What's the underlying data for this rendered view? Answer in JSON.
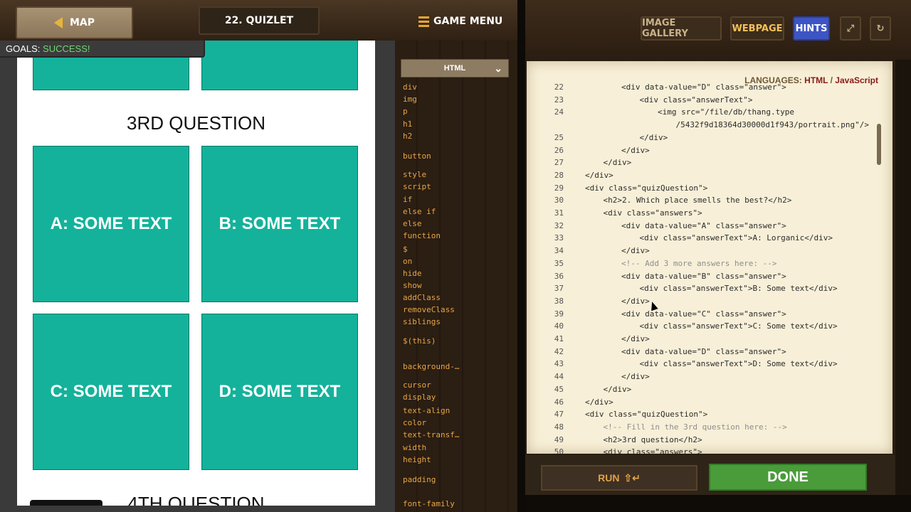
{
  "topbar": {
    "map_label": "MAP",
    "level_title": "22. QUIZLET",
    "game_menu_label": "GAME MENU",
    "goals_label": "GOALS:",
    "goals_status": "SUCCESS!",
    "colors": {
      "goals_status": "#6ed86e",
      "map_arrow": "#e6b53a"
    }
  },
  "preview": {
    "third_question_heading": "3RD QUESTION",
    "fourth_question_heading": "4TH QUESTION",
    "tiles": [
      "A: SOME TEXT",
      "B: SOME TEXT",
      "C: SOME TEXT",
      "D: SOME TEXT"
    ],
    "tile_color": "#14b29b"
  },
  "palette": {
    "dropdown_label": "HTML",
    "items": [
      "div",
      "img",
      "p",
      "h1",
      "h2",
      "button",
      "style",
      "script",
      "if",
      "else if",
      "else",
      "function",
      "$",
      "on",
      "hide",
      "show",
      "addClass",
      "removeClass",
      "siblings",
      "$(this)",
      "background-…",
      "cursor",
      "display",
      "text-align",
      "color",
      "text-transf…",
      "width",
      "height",
      "padding",
      "font-family"
    ]
  },
  "toolbar": {
    "image_gallery_label": "IMAGE GALLERY",
    "webpage_label": "WEBPAGE",
    "hints_label": "HINTS",
    "fullscreen_icon": "expand-icon",
    "reload_icon": "reload-icon"
  },
  "editor": {
    "languages_prefix": "LANGUAGES:",
    "language_html": "HTML",
    "language_sep": "/",
    "language_js": "JavaScript",
    "lines": [
      {
        "n": "22",
        "text": "<div data-value=\"D\" class=\"answer\">",
        "indent": 2
      },
      {
        "n": "23",
        "text": "<div class=\"answerText\">",
        "indent": 3
      },
      {
        "n": "24",
        "text": "<img src=\"/file/db/thang.type",
        "indent": 4
      },
      {
        "n": "",
        "text": "/5432f9d18364d30000d1f943/portrait.png\"/>",
        "indent": 5
      },
      {
        "n": "25",
        "text": "</div>",
        "indent": 3
      },
      {
        "n": "26",
        "text": "</div>",
        "indent": 2
      },
      {
        "n": "27",
        "text": "</div>",
        "indent": 1
      },
      {
        "n": "28",
        "text": "</div>",
        "indent": 0
      },
      {
        "n": "29",
        "text": "<div class=\"quizQuestion\">",
        "indent": 0
      },
      {
        "n": "30",
        "text": "<h2>2. Which place smells the best?</h2>",
        "indent": 1
      },
      {
        "n": "31",
        "text": "<div class=\"answers\">",
        "indent": 1
      },
      {
        "n": "32",
        "text": "<div data-value=\"A\" class=\"answer\">",
        "indent": 2
      },
      {
        "n": "33",
        "text": "<div class=\"answerText\">A: Lorganic</div>",
        "indent": 3
      },
      {
        "n": "34",
        "text": "</div>",
        "indent": 2
      },
      {
        "n": "35",
        "text": "<!-- Add 3 more answers here: -->",
        "indent": 2,
        "comment": true
      },
      {
        "n": "36",
        "text": "<div data-value=\"B\" class=\"answer\">",
        "indent": 2
      },
      {
        "n": "37",
        "text": "<div class=\"answerText\">B: Some text</div>",
        "indent": 3
      },
      {
        "n": "38",
        "text": "</div>",
        "indent": 2
      },
      {
        "n": "39",
        "text": "<div data-value=\"C\" class=\"answer\">",
        "indent": 2
      },
      {
        "n": "40",
        "text": "<div class=\"answerText\">C: Some text</div>",
        "indent": 3
      },
      {
        "n": "41",
        "text": "</div>",
        "indent": 2
      },
      {
        "n": "42",
        "text": "<div data-value=\"D\" class=\"answer\">",
        "indent": 2
      },
      {
        "n": "43",
        "text": "<div class=\"answerText\">D: Some text</div>",
        "indent": 3
      },
      {
        "n": "44",
        "text": "</div>",
        "indent": 2
      },
      {
        "n": "45",
        "text": "</div>",
        "indent": 1
      },
      {
        "n": "46",
        "text": "</div>",
        "indent": 0
      },
      {
        "n": "47",
        "text": "<div class=\"quizQuestion\">",
        "indent": 0
      },
      {
        "n": "48",
        "text": "<!-- Fill in the 3rd question here: -->",
        "indent": 1,
        "comment": true
      },
      {
        "n": "49",
        "text": "<h2>3rd question</h2>",
        "indent": 1
      },
      {
        "n": "50",
        "text": "<div class=\"answers\">",
        "indent": 1
      }
    ]
  },
  "bottom": {
    "run_label": "RUN",
    "run_shortcut": "⇧↵",
    "done_label": "DONE",
    "done_color": "#4a9b3a"
  }
}
